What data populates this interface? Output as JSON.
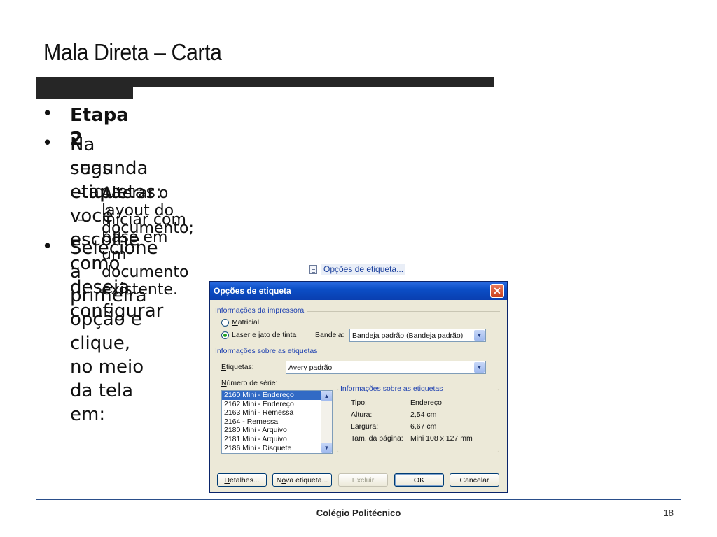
{
  "slide": {
    "title": "Mala Direta – Carta",
    "bullets": [
      {
        "text": "Etapa 2"
      },
      {
        "line1": "Na segunda etapa você escolhe como deseja configurar",
        "line2": "suas etiquetas:"
      },
      {
        "text": "Selecione a primeira opção e clique, no meio da tela em:"
      }
    ],
    "sub_bullets": [
      {
        "dash": "–",
        "text": "Alterar o layout do documento;"
      },
      {
        "dash": "–",
        "text": "iniciar com base em um documento existente."
      }
    ],
    "bullet_glyph": "•",
    "options_link": {
      "label": "Opções de etiqueta...",
      "icon": "document-icon"
    }
  },
  "dialog": {
    "title": "Opções de etiqueta",
    "close_glyph": "✕",
    "printer_group_label": "Informações da impressora",
    "radio_matricial": {
      "first": "M",
      "rest": "atricial",
      "selected": false
    },
    "radio_laser": {
      "first": "L",
      "rest": "aser e jato de tinta",
      "selected": true
    },
    "tray_label": {
      "first": "B",
      "rest": "andeja:"
    },
    "tray_value": "Bandeja padrão (Bandeja padrão)",
    "labels_group_label": "Informações sobre as etiquetas",
    "labels_field_label": {
      "first": "E",
      "rest": "tiquetas:"
    },
    "labels_value": "Avery padrão",
    "serial_label": {
      "first": "N",
      "rest": "úmero de série:"
    },
    "serial_items": [
      "2160 Mini - Endereço",
      "2162 Mini - Endereço",
      "2163 Mini - Remessa",
      "2164 - Remessa",
      "2180 Mini - Arquivo",
      "2181 Mini - Arquivo",
      "2186 Mini - Disquete"
    ],
    "selected_serial_index": 0,
    "info_title": "Informações sobre as etiquetas",
    "info_rows": [
      {
        "key": "Tipo:",
        "value": "Endereço"
      },
      {
        "key": "Altura:",
        "value": "2,54 cm"
      },
      {
        "key": "Largura:",
        "value": "6,67 cm"
      },
      {
        "key": "Tam. da página:",
        "value": "Mini 108 x 127 mm"
      }
    ],
    "buttons": {
      "details": {
        "first": "D",
        "rest": "etalhes..."
      },
      "new_label": {
        "pre": "N",
        "u": "o",
        "rest": "va etiqueta..."
      },
      "delete": "Excluir",
      "ok": "OK",
      "cancel": "Cancelar"
    },
    "dropdown_glyph": "▼",
    "scroll_up_glyph": "▲",
    "scroll_down_glyph": "▼"
  },
  "footer": {
    "center": "Colégio Politécnico",
    "page": "18"
  },
  "colors": {
    "title_bar": "#0b4ec6",
    "group_label": "#1c3fb0",
    "dialog_bg": "#ece9d8",
    "selection": "#316ac5",
    "slide_bar": "#262626",
    "footer_line": "#2a4e8a"
  }
}
